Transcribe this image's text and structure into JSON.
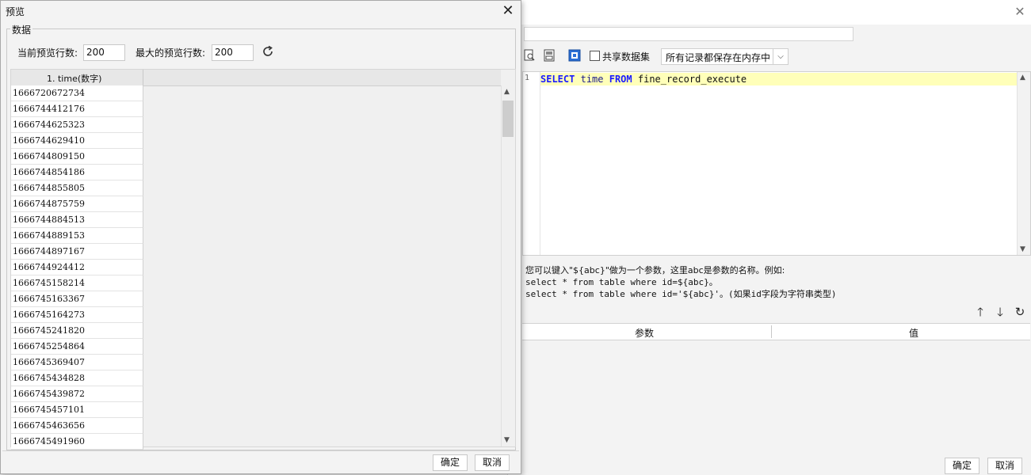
{
  "background_dialog": {
    "toolbar": {
      "share_dataset_label": "共享数据集",
      "cache_mode_value": "所有记录都保存在内存中"
    },
    "sql": {
      "line_number": "1",
      "keyword_select": "SELECT",
      "column": "time",
      "keyword_from": "FROM",
      "table": "fine_record_execute"
    },
    "hint": {
      "line1": "您可以键入\"${abc}\"做为一个参数，这里abc是参数的名称。例如:",
      "line2": "select * from table where id=${abc}。",
      "line3": "select * from table where id='${abc}'。(如果id字段为字符串类型)"
    },
    "param_table": {
      "col_param": "参数",
      "col_value": "值"
    },
    "ok_label": "确定",
    "cancel_label": "取消"
  },
  "preview_dialog": {
    "title": "预览",
    "group_label": "数据",
    "current_rows_label": "当前预览行数:",
    "current_rows_value": "200",
    "max_rows_label": "最大的预览行数:",
    "max_rows_value": "200",
    "column_header": "1.  time(数字)",
    "rows": [
      "1666720672734",
      "1666744412176",
      "1666744625323",
      "1666744629410",
      "1666744809150",
      "1666744854186",
      "1666744855805",
      "1666744875759",
      "1666744884513",
      "1666744889153",
      "1666744897167",
      "1666744924412",
      "1666745158214",
      "1666745163367",
      "1666745164273",
      "1666745241820",
      "1666745254864",
      "1666745369407",
      "1666745434828",
      "1666745439872",
      "1666745457101",
      "1666745463656",
      "1666745491960"
    ],
    "ok_label": "确定",
    "cancel_label": "取消"
  },
  "colors": {
    "sql_keyword": "#1a1aff",
    "sql_current_line": "#ffffb9",
    "dialog_bg": "#f3f3f3"
  }
}
